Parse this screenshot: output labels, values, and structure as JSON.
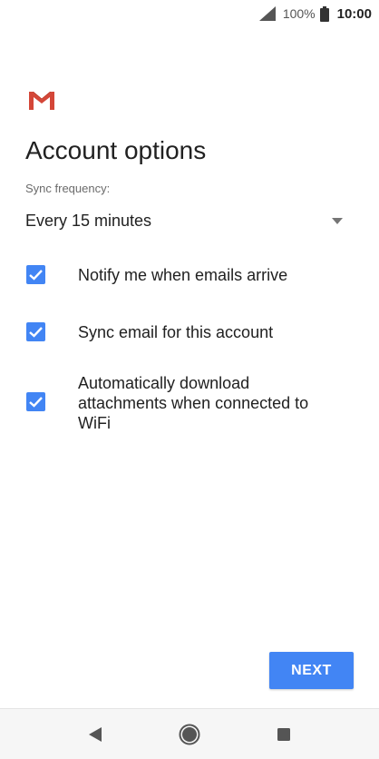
{
  "status_bar": {
    "battery_percent": "100%",
    "time": "10:00",
    "icons": [
      "signal-icon",
      "battery-icon"
    ]
  },
  "app": {
    "logo": "gmail-logo"
  },
  "page": {
    "title": "Account options"
  },
  "sync": {
    "label": "Sync frequency:",
    "value": "Every 15 minutes"
  },
  "options": [
    {
      "label": "Notify me when emails arrive",
      "checked": true
    },
    {
      "label": "Sync email for this account",
      "checked": true
    },
    {
      "label": "Automatically download attachments when connected to WiFi",
      "checked": true
    }
  ],
  "actions": {
    "next_label": "NEXT"
  },
  "nav": {
    "icons": [
      "back-icon",
      "home-icon",
      "recents-icon"
    ]
  },
  "colors": {
    "accent": "#4285f4",
    "gmail_red": "#d44638"
  }
}
